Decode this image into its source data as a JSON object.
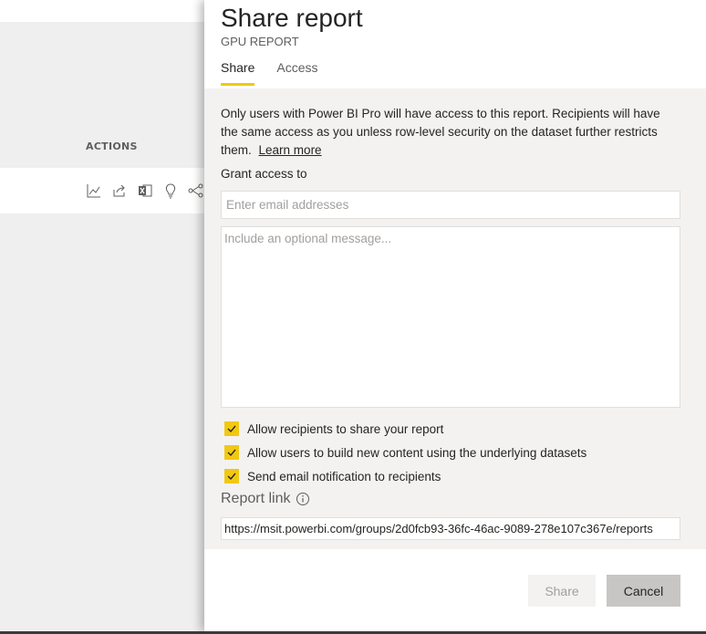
{
  "background": {
    "actions_label": "ACTIONS",
    "row_icons": [
      "chart-line-icon",
      "share-arrow-icon",
      "excel-icon",
      "lightbulb-icon",
      "lineage-icon"
    ]
  },
  "panel": {
    "title": "Share report",
    "subtitle": "GPU REPORT",
    "tabs": [
      {
        "label": "Share",
        "active": true
      },
      {
        "label": "Access",
        "active": false
      }
    ],
    "info_text": "Only users with Power BI Pro will have access to this report. Recipients will have the same access as you unless row-level security on the dataset further restricts them.",
    "learn_more": "Learn more",
    "grant_label": "Grant access to",
    "email_placeholder": "Enter email addresses",
    "message_placeholder": "Include an optional message...",
    "checkboxes": [
      {
        "label": "Allow recipients to share your report",
        "checked": true
      },
      {
        "label": "Allow users to build new content using the underlying datasets",
        "checked": true
      },
      {
        "label": "Send email notification to recipients",
        "checked": true
      }
    ],
    "report_link_label": "Report link",
    "report_link_value": "https://msit.powerbi.com/groups/2d0fcb93-36fc-46ac-9089-278e107c367e/reports",
    "share_button": "Share",
    "cancel_button": "Cancel"
  },
  "colors": {
    "accent": "#f2c811",
    "panel_content_bg": "#f3f2f1",
    "app_bg": "#efefef"
  }
}
